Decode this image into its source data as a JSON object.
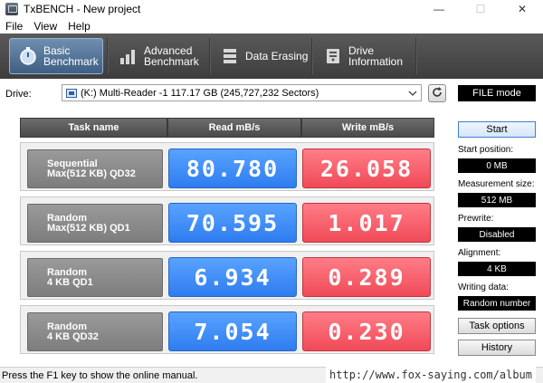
{
  "window": {
    "title": "TxBENCH - New project",
    "minimize": "—",
    "maximize": "☐",
    "close": "✕"
  },
  "menu": [
    "File",
    "View",
    "Help"
  ],
  "tabs": [
    {
      "line1": "Basic",
      "line2": "Benchmark",
      "icon": "stopwatch-icon",
      "active": true
    },
    {
      "line1": "Advanced",
      "line2": "Benchmark",
      "icon": "bar-chart-icon",
      "active": false
    },
    {
      "line1": "Data Erasing",
      "line2": "",
      "icon": "eraser-icon",
      "active": false
    },
    {
      "line1": "Drive",
      "line2": "Information",
      "icon": "drive-info-icon",
      "active": false
    }
  ],
  "drive": {
    "label": "Drive:",
    "selected": "(K:) Multi-Reader  -1  117.17 GB (245,727,232 Sectors)"
  },
  "file_mode": "FILE mode",
  "table": {
    "headers": {
      "task": "Task name",
      "read": "Read mB/s",
      "write": "Write mB/s"
    },
    "rows": [
      {
        "task": "Sequential\nMax(512 KB) QD32",
        "read": "80.780",
        "write": "26.058"
      },
      {
        "task": "Random\nMax(512 KB) QD1",
        "read": "70.595",
        "write": "1.017"
      },
      {
        "task": "Random\n4 KB QD1",
        "read": "6.934",
        "write": "0.289"
      },
      {
        "task": "Random\n4 KB QD32",
        "read": "7.054",
        "write": "0.230"
      }
    ]
  },
  "sidebar": {
    "start": "Start",
    "start_position_label": "Start position:",
    "start_position": "0 MB",
    "measurement_size_label": "Measurement size:",
    "measurement_size": "512 MB",
    "prewrite_label": "Prewrite:",
    "prewrite": "Disabled",
    "alignment_label": "Alignment:",
    "alignment": "4 KB",
    "writing_data_label": "Writing data:",
    "writing_data": "Random number",
    "task_options": "Task options",
    "history": "History"
  },
  "status": "Press the F1 key to show the online manual.",
  "watermark": "http://www.fox-saying.com/album",
  "colors": {
    "read": "#3b86f6",
    "write": "#f55b67",
    "toolbar": "#4a4a4a"
  }
}
